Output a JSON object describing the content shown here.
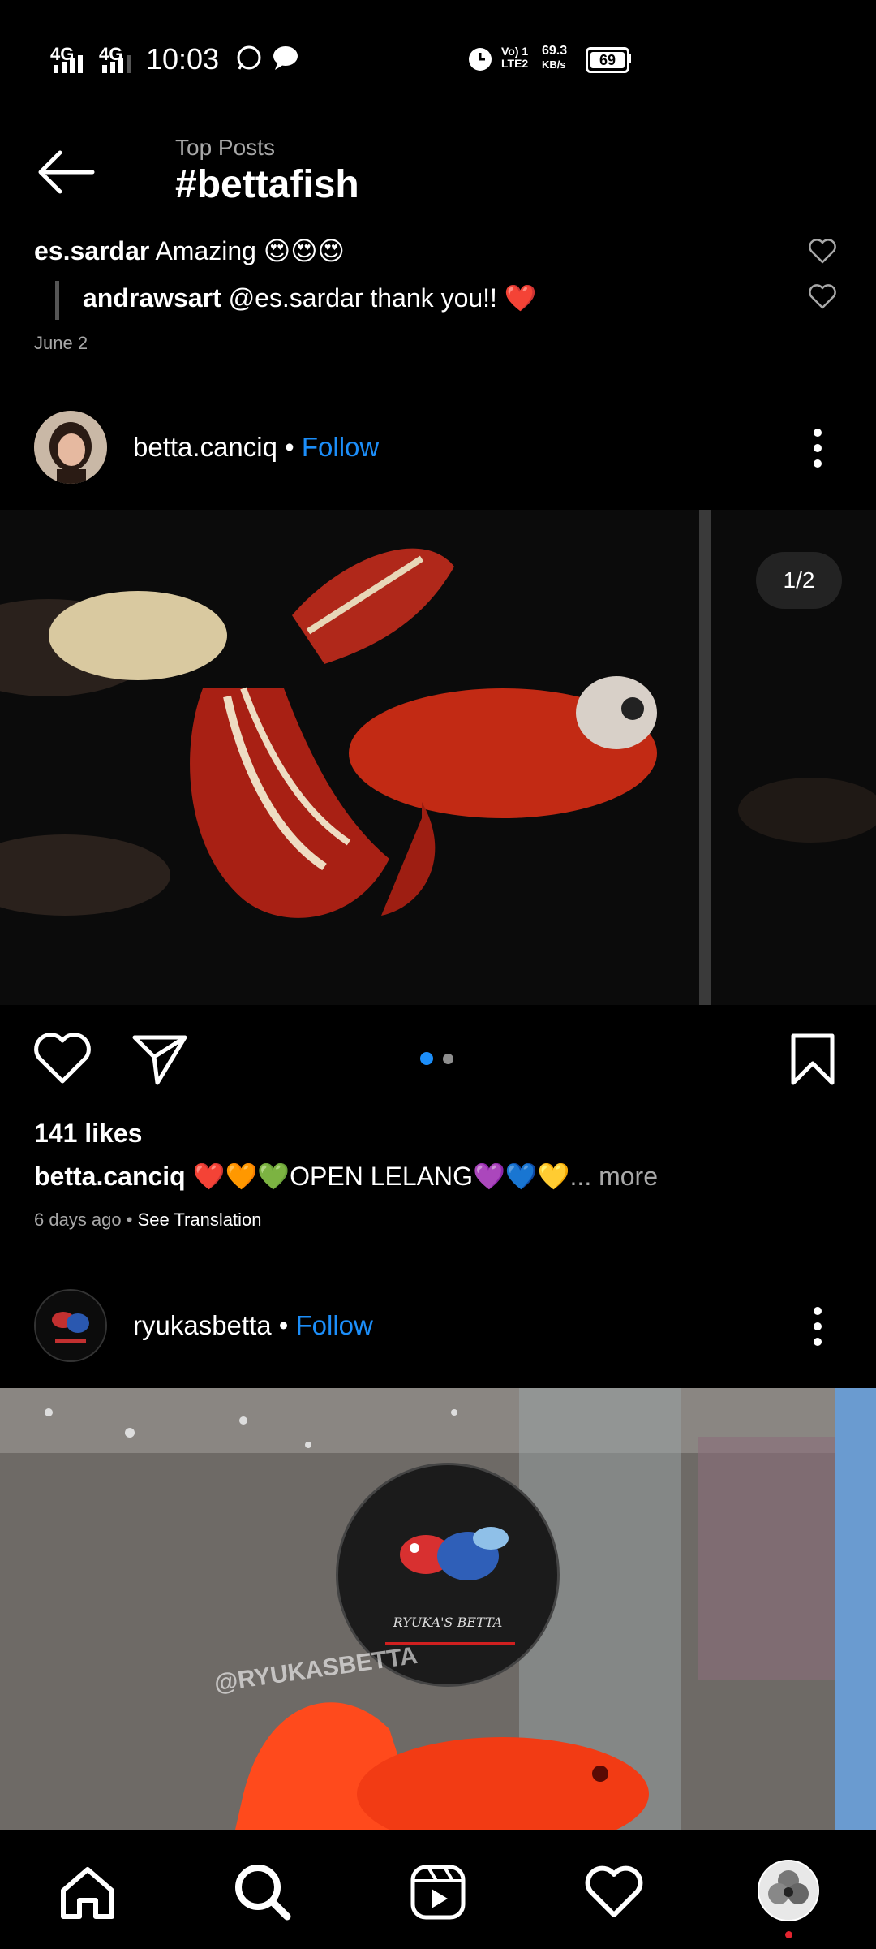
{
  "status_bar": {
    "net1": "4G",
    "net2": "4G",
    "time": "10:03",
    "volte": "Vo) 1\nLTE2",
    "speed_value": "69.3",
    "speed_unit": "KB/s",
    "battery": "69"
  },
  "header": {
    "subtitle": "Top Posts",
    "title": "#bettafish"
  },
  "comments": [
    {
      "user": "es.sardar",
      "text": " Amazing 😍😍😍"
    },
    {
      "user": "andrawsart",
      "text": " @es.sardar thank you!! ❤️"
    }
  ],
  "comments_date": "June 2",
  "post1": {
    "username": "betta.canciq",
    "separator": " • ",
    "follow": "Follow",
    "counter": "1/2",
    "likes": "141 likes",
    "caption_user": "betta.canciq",
    "caption_text": " ❤️🧡💚OPEN LELANG💜💙💛",
    "more": "... more",
    "time": "6 days ago",
    "translate_sep": " • ",
    "translate": "See Translation"
  },
  "post2": {
    "username": "ryukasbetta",
    "separator": " • ",
    "follow": "Follow",
    "logo_text": "RYUKA'S BETTA",
    "watermark": "@RYUKASBETTA"
  },
  "nav": {
    "items": [
      "home-icon",
      "search-icon",
      "reels-icon",
      "heart-icon",
      "profile-avatar"
    ]
  },
  "colors": {
    "accent": "#1c8ef9",
    "background": "#000000",
    "like_red": "#e2242f"
  }
}
